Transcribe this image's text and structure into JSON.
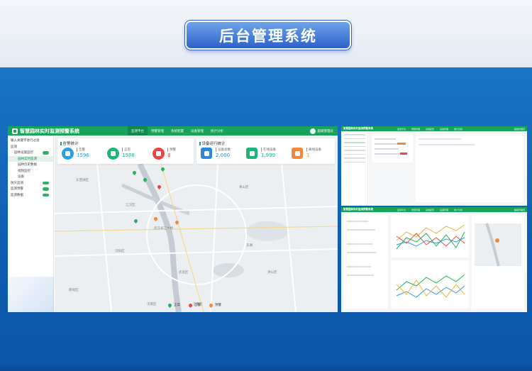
{
  "page": {
    "title": "后台管理系统"
  },
  "app": {
    "title": "智慧园林实时监测预警系统",
    "nav": [
      "监测平台",
      "预警管理",
      "系统配置",
      "设备管理",
      "统计分析"
    ],
    "active_nav": 0,
    "user": "超级管理员"
  },
  "sidebar": {
    "items": [
      {
        "label": "输入关键字进行过滤",
        "level": 1,
        "toggle": false,
        "selected": false
      },
      {
        "label": "监测",
        "level": 1,
        "toggle": false,
        "selected": false
      },
      {
        "label": "园林设施监控",
        "level": 2,
        "toggle": true,
        "selected": false
      },
      {
        "label": "园林实时监测",
        "level": 3,
        "toggle": false,
        "selected": true
      },
      {
        "label": "园林历史数据",
        "level": 3,
        "toggle": false,
        "selected": false
      },
      {
        "label": "视频监控",
        "level": 3,
        "toggle": false,
        "selected": false
      },
      {
        "label": "设备",
        "level": 3,
        "toggle": false,
        "selected": false
      },
      {
        "label": "防灾监测",
        "level": 1,
        "toggle": true,
        "selected": false
      },
      {
        "label": "监测预警",
        "level": 1,
        "toggle": true,
        "selected": false
      },
      {
        "label": "监测数据",
        "level": 1,
        "toggle": true,
        "selected": false
      }
    ]
  },
  "cards": {
    "alarm": {
      "title": "告警统计",
      "stats": [
        {
          "label": "告警",
          "value": "1596",
          "color": "#27a0e5"
        },
        {
          "label": "正常",
          "value": "1588",
          "color": "#1fb579"
        },
        {
          "label": "预警",
          "value": "8",
          "color": "#e84747"
        }
      ]
    },
    "device": {
      "title": "设备运行统计",
      "stats": [
        {
          "label": "设备总数",
          "value": "2,000",
          "color": "#2f86d9"
        },
        {
          "label": "在线设备",
          "value": "1,999",
          "color": "#1fb579"
        },
        {
          "label": "离线设备",
          "value": "1",
          "color": "#f08a3a"
        }
      ]
    }
  },
  "map": {
    "labels": [
      "东湖",
      "武汉长江大桥",
      "江汉区",
      "武昌区",
      "洪山区",
      "汉阳区",
      "青山区",
      "蔡甸区",
      "江夏区",
      "东西湖区",
      "汉南区"
    ],
    "legend": [
      {
        "label": "正常",
        "color": "#1fb55a"
      },
      {
        "label": "告警",
        "color": "#e84747"
      },
      {
        "label": "预警",
        "color": "#f08a3a"
      }
    ]
  },
  "mini": {
    "title": "智慧园林实时监测预警系统",
    "nav": [
      "监测平台",
      "预警管理",
      "系统配置",
      "设备管理",
      "统计分析"
    ],
    "user": "超级管理员"
  }
}
